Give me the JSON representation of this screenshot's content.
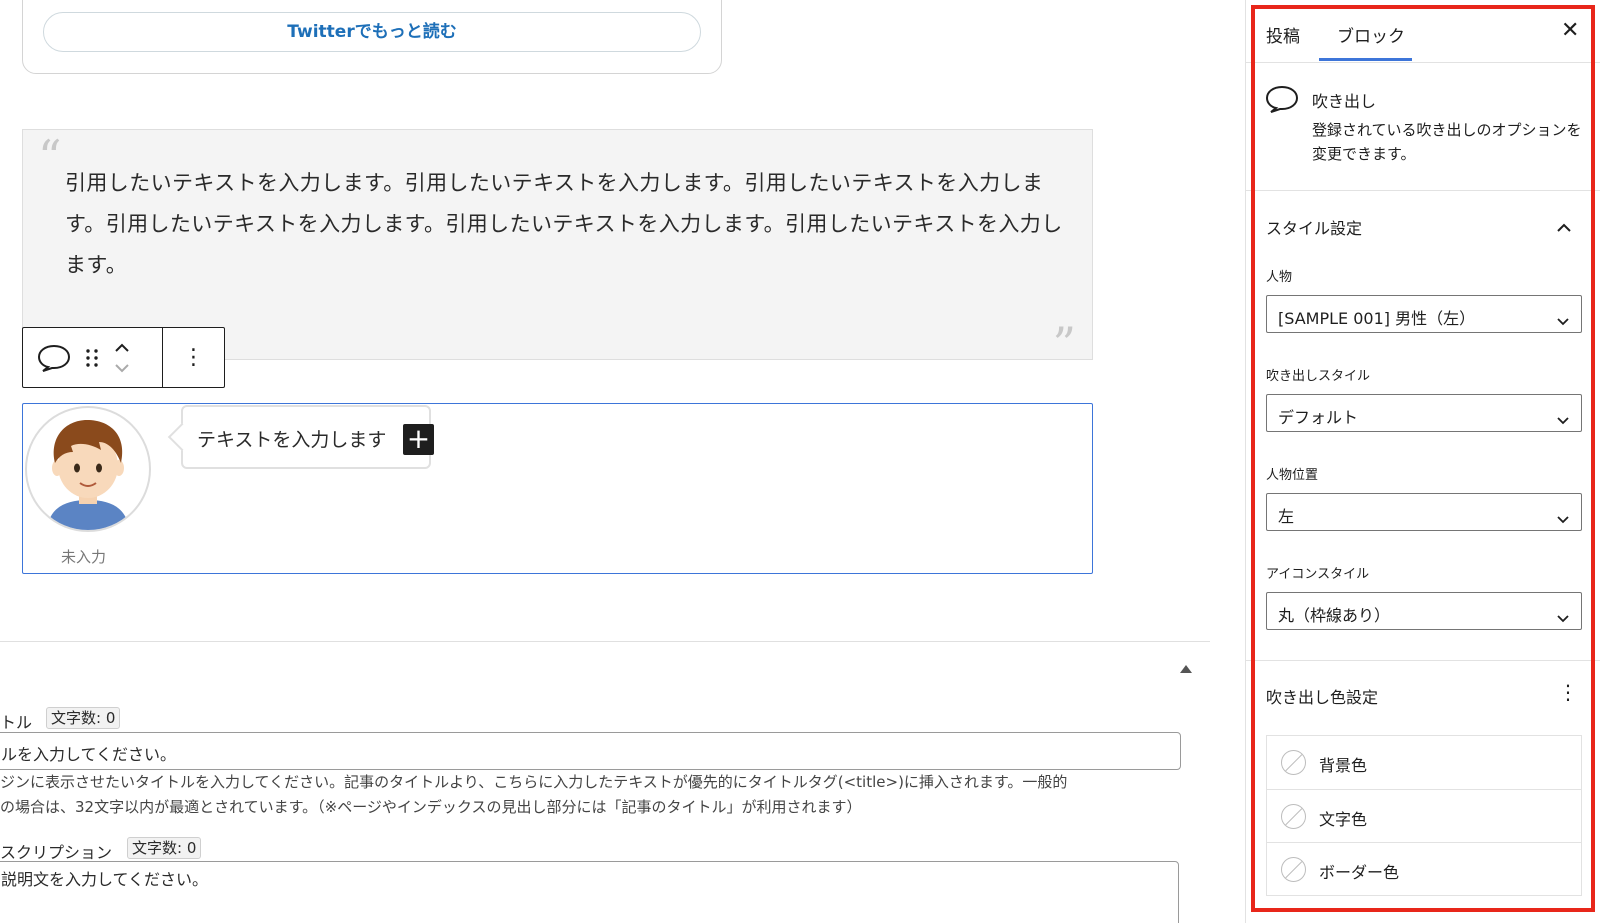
{
  "editor": {
    "twitter_button": "Twitterでもっと読む",
    "quote": {
      "text": "引用したいテキストを入力します。引用したいテキストを入力します。引用したいテキストを入力します。引用したいテキストを入力します。引用したいテキストを入力します。引用したいテキストを入力します。",
      "open_mark": "“",
      "close_mark": "”"
    },
    "toolbar": {
      "more_glyph": "⋮"
    },
    "balloon": {
      "text": "テキストを入力します",
      "inserter_glyph": "+",
      "avatar_name": "未入力"
    }
  },
  "meta": {
    "title_label": "トル",
    "title_count": "文字数: 0",
    "title_placeholder": "ルを入力してください。",
    "title_help_1": "ジンに表示させたいタイトルを入力してください。記事のタイトルより、こちらに入力したテキストが優先的にタイトルタグ(<title>)に挿入されます。一般的",
    "title_help_2": "の場合は、32文字以内が最適とされています。（※ページやインデックスの見出し部分には「記事のタイトル」が利用されます）",
    "desc_label": "スクリプション",
    "desc_count": "文字数: 0",
    "desc_placeholder": "説明文を入力してください。"
  },
  "sidebar": {
    "tabs": [
      "投稿",
      "ブロック"
    ],
    "active_tab": "ブロック",
    "close_glyph": "✕",
    "block": {
      "name": "吹き出し",
      "description": "登録されている吹き出しのオプションを変更できます。",
      "icon": "speech-bubble-icon"
    },
    "style_panel": {
      "title": "スタイル設定",
      "fields": [
        {
          "label": "人物",
          "value": "[SAMPLE 001] 男性（左）"
        },
        {
          "label": "吹き出しスタイル",
          "value": "デフォルト"
        },
        {
          "label": "人物位置",
          "value": "左"
        },
        {
          "label": "アイコンスタイル",
          "value": "丸（枠線あり）"
        }
      ]
    },
    "color_panel": {
      "title": "吹き出し色設定",
      "menu_glyph": "⋮",
      "items": [
        "背景色",
        "文字色",
        "ボーダー色"
      ]
    }
  },
  "colors": {
    "accent": "#3d75d9",
    "highlight": "#e8261a",
    "twitter_link": "#1d6fb8"
  }
}
